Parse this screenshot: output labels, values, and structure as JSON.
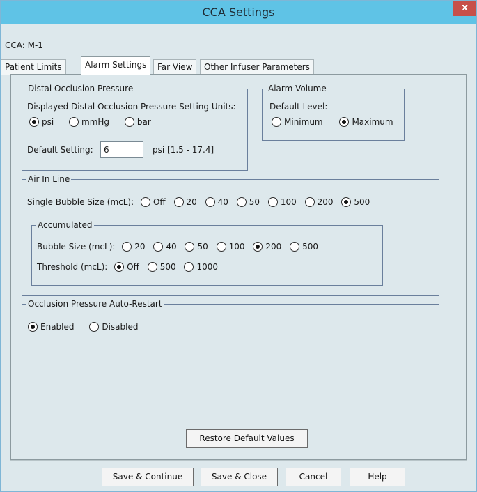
{
  "window": {
    "title": "CCA Settings",
    "close_glyph": "x"
  },
  "cca_label": "CCA: M-1",
  "tabs": [
    {
      "label": "Patient Limits",
      "active": false
    },
    {
      "label": "Alarm Settings",
      "active": true
    },
    {
      "label": "Far View",
      "active": false
    },
    {
      "label": "Other Infuser Parameters",
      "active": false
    }
  ],
  "distal": {
    "legend": "Distal Occlusion Pressure",
    "units_label": "Displayed Distal Occlusion Pressure Setting Units:",
    "units_options": [
      "psi",
      "mmHg",
      "bar"
    ],
    "units_selected": "psi",
    "default_label": "Default Setting:",
    "default_value": "6",
    "default_unit_range": "psi  [1.5 - 17.4]"
  },
  "alarm_volume": {
    "legend": "Alarm Volume",
    "level_label": "Default Level:",
    "options": [
      "Minimum",
      "Maximum"
    ],
    "selected": "Maximum"
  },
  "air_in_line": {
    "legend": "Air In Line",
    "single_label": "Single Bubble Size (mcL):",
    "single_options": [
      "Off",
      "20",
      "40",
      "50",
      "100",
      "200",
      "500"
    ],
    "single_selected": "500",
    "accumulated": {
      "legend": "Accumulated",
      "bubble_label": "Bubble Size (mcL):",
      "bubble_options": [
        "20",
        "40",
        "50",
        "100",
        "200",
        "500"
      ],
      "bubble_selected": "200",
      "threshold_label": "Threshold (mcL):",
      "threshold_options": [
        "Off",
        "500",
        "1000"
      ],
      "threshold_selected": "Off"
    }
  },
  "occlusion_restart": {
    "legend": "Occlusion Pressure Auto-Restart",
    "options": [
      "Enabled",
      "Disabled"
    ],
    "selected": "Enabled"
  },
  "buttons": {
    "restore": "Restore Default Values",
    "save_continue": "Save & Continue",
    "save_close": "Save & Close",
    "cancel": "Cancel",
    "help": "Help"
  }
}
